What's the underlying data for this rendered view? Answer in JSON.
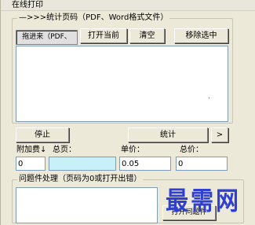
{
  "window": {
    "title": "在线打印"
  },
  "count_group": {
    "legend": "—>>>统计页码（PDF、Word格式文件）",
    "drag_in_label": "拖进来（PDF、DOC）",
    "open_current_label": "打开当前",
    "clear_label": "清空",
    "remove_selected_label": "移除选中",
    "stop_label": "停止",
    "count_label": "统计",
    "more_label": ">"
  },
  "fees": {
    "surcharge_label": "附加费↓",
    "surcharge_value": "0",
    "total_pages_label": "总页：",
    "total_pages_value": "",
    "unit_price_label": "单价：",
    "unit_price_value": "0.05",
    "total_price_label": "总价：",
    "total_price_value": "0"
  },
  "problem_group": {
    "legend": "问题件处理（页码为0或打开出错）",
    "open_problem_label": "打开问题件"
  },
  "watermark": {
    "text": "最需网"
  }
}
